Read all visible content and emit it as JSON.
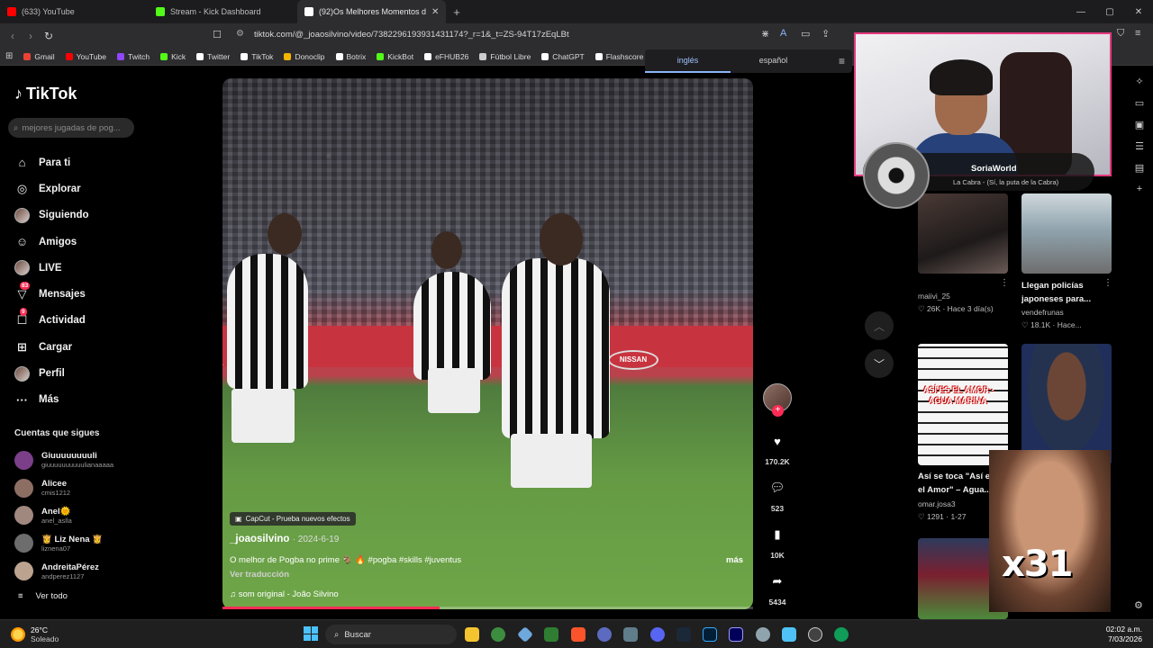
{
  "browser": {
    "tabs": [
      {
        "label": "(633) YouTube",
        "color": "#ff0000"
      },
      {
        "label": "Stream - Kick Dashboard",
        "color": "#53fc18"
      },
      {
        "label": "(92)Os Melhores Momentos d",
        "color": "#ffffff",
        "active": true
      }
    ],
    "url": "tiktok.com/@_joaosilvino/video/7382296193931431174?_r=1&_t=ZS-94T17zEqLBt",
    "bookmarks": [
      {
        "label": "Gmail",
        "color": "#ea4335"
      },
      {
        "label": "YouTube",
        "color": "#ff0000"
      },
      {
        "label": "Twitch",
        "color": "#9146ff"
      },
      {
        "label": "Kick",
        "color": "#53fc18"
      },
      {
        "label": "Twitter",
        "color": "#ffffff"
      },
      {
        "label": "TikTok",
        "color": "#ffffff"
      },
      {
        "label": "Donoclip",
        "color": "#f4b400"
      },
      {
        "label": "Botrix",
        "color": "#ffffff"
      },
      {
        "label": "KickBot",
        "color": "#53fc18"
      },
      {
        "label": "eFHUB26",
        "color": "#ffffff"
      },
      {
        "label": "Fútbol Libre",
        "color": "#cccccc"
      },
      {
        "label": "ChatGPT",
        "color": "#ffffff"
      },
      {
        "label": "Flashscore",
        "color": "#ffffff"
      }
    ],
    "translate": {
      "option_1": "inglés",
      "option_2": "español"
    }
  },
  "tiktok": {
    "logo": "TikTok",
    "search_placeholder": "mejores jugadas de pog...",
    "nav": [
      {
        "label": "Para ti",
        "icon": "home-icon",
        "glyph": "⌂"
      },
      {
        "label": "Explorar",
        "icon": "compass-icon",
        "glyph": "◎"
      },
      {
        "label": "Siguiendo",
        "icon": "avatar-icon",
        "glyph": ""
      },
      {
        "label": "Amigos",
        "icon": "friends-icon",
        "glyph": "☺"
      },
      {
        "label": "LIVE",
        "icon": "live-icon",
        "glyph": ""
      },
      {
        "label": "Mensajes",
        "icon": "messages-icon",
        "glyph": "▽",
        "badge": "83"
      },
      {
        "label": "Actividad",
        "icon": "activity-icon",
        "glyph": "☐",
        "badge": "9"
      },
      {
        "label": "Cargar",
        "icon": "upload-icon",
        "glyph": "⊞"
      },
      {
        "label": "Perfil",
        "icon": "profile-icon",
        "glyph": ""
      },
      {
        "label": "Más",
        "icon": "more-icon",
        "glyph": "···"
      }
    ],
    "following_title": "Cuentas que sigues",
    "following": [
      {
        "name": "Giuuuuuuuuli",
        "handle": "giuuuuuuuuuulianaaaaa",
        "color": "#7b3f8a"
      },
      {
        "name": "Alicee",
        "handle": "cmis1212",
        "color": "#8d6e63"
      },
      {
        "name": "Anel🌞",
        "handle": "anel_aslla",
        "color": "#a1887f"
      },
      {
        "name": "👸 Liz Nena 👸",
        "handle": "liznena07",
        "color": "#6d6d6d"
      },
      {
        "name": "AndreitaPérez",
        "handle": "andperez1127",
        "color": "#bca38f"
      }
    ],
    "see_all": "Ver todo",
    "video": {
      "billboard": "ISSAN",
      "sponsor": "NISSAN",
      "capcut": "CapCut - Prueba nuevos efectos",
      "author": "_joaosilvino",
      "date": "2024-6-19",
      "caption": "O melhor de Pogba no prime 🐐 🔥 #pogba #skills #juventus",
      "more": "más",
      "translation": "Ver traducción",
      "sound": "♫  som original - João Silvino",
      "progress": 0.41
    },
    "actions": {
      "likes": "170.2K",
      "comments": "523",
      "saves": "10K",
      "shares": "5434"
    }
  },
  "stream_overlay": {
    "song_title": "SoriaWorld",
    "song_subtitle": "La Cabra - (Sí, la puta de la Cabra)",
    "meme_text": "x31"
  },
  "feed": [
    {
      "meta_user": "maiivi_25",
      "stats": "♡ 26K · Hace 3 día(s)"
    },
    {
      "title_1": "Llegan policías",
      "title_2": "japoneses para...",
      "meta_user": "vendefrunas",
      "stats": "♡ 18.1K · Hace..."
    },
    {
      "thumb_text_1": "ASÍ ES EL AMOR -",
      "thumb_text_2": "AGUA MARINA",
      "title_1": "Así se toca \"Así e",
      "title_2": "el Amor\" – Agua...",
      "meta_user": "omar.josa3",
      "stats": "♡ 1291 · 1-27"
    }
  ],
  "taskbar": {
    "temp": "26°C",
    "weather": "Soleado",
    "search": "Buscar",
    "time": "02:02 a.m.",
    "date": "7/03/2026"
  }
}
